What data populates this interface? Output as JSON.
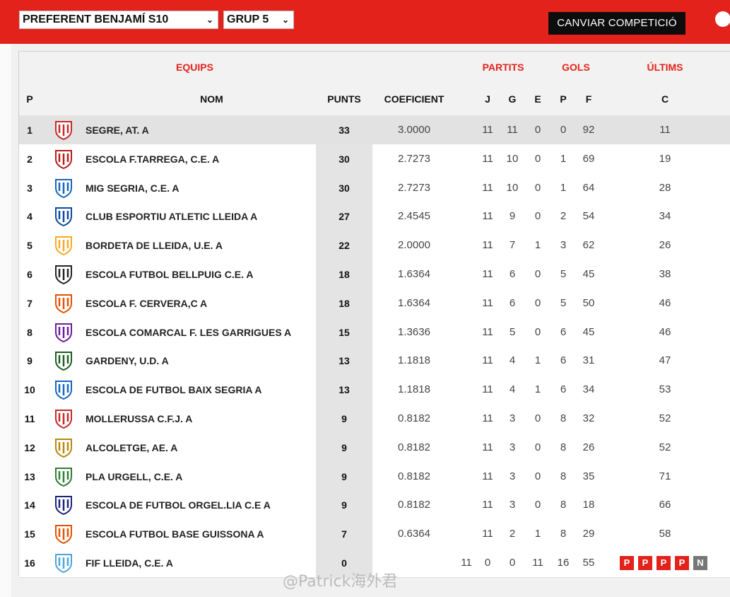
{
  "header": {
    "competition_select": "PREFERENT BENJAMÍ S10",
    "group_select": "GRUP 5",
    "change_button": "CANVIAR COMPETICIÓ"
  },
  "colors": {
    "accent": "#e3231b",
    "loss_badge": "#e3231b",
    "draw_badge": "#777777"
  },
  "table": {
    "group_headers": {
      "equips": "EQUIPS",
      "partits": "PARTITS",
      "gols": "GOLS",
      "ultims": "ÚLTIMS"
    },
    "columns": {
      "p": "P",
      "nom": "NOM",
      "punts": "PUNTS",
      "coeficient": "COEFICIENT",
      "j": "J",
      "g": "G",
      "e": "E",
      "pp": "P",
      "f": "F",
      "c": "C"
    },
    "rows": [
      {
        "pos": "1",
        "name": "SEGRE, AT. A",
        "pts": "33",
        "coef": "3.0000",
        "j": "11",
        "g": "11",
        "e": "0",
        "p": "0",
        "f": "92",
        "c": "11",
        "logo_icon": "shield-red-white-stripes-icon"
      },
      {
        "pos": "2",
        "name": "ESCOLA F.TARREGA, C.E. A",
        "pts": "30",
        "coef": "2.7273",
        "j": "11",
        "g": "10",
        "e": "0",
        "p": "1",
        "f": "69",
        "c": "19",
        "logo_icon": "round-crest-red-icon"
      },
      {
        "pos": "3",
        "name": "MIG SEGRIA, C.E. A",
        "pts": "30",
        "coef": "2.7273",
        "j": "11",
        "g": "10",
        "e": "0",
        "p": "1",
        "f": "64",
        "c": "28",
        "logo_icon": "diamond-crest-blue-icon"
      },
      {
        "pos": "4",
        "name": "CLUB ESPORTIU ATLETIC LLEIDA A",
        "pts": "27",
        "coef": "2.4545",
        "j": "11",
        "g": "9",
        "e": "0",
        "p": "2",
        "f": "54",
        "c": "34",
        "logo_icon": "round-crest-blue-icon"
      },
      {
        "pos": "5",
        "name": "BORDETA DE LLEIDA, U.E. A",
        "pts": "22",
        "coef": "2.0000",
        "j": "11",
        "g": "7",
        "e": "1",
        "p": "3",
        "f": "62",
        "c": "26",
        "logo_icon": "shield-yellow-red-icon"
      },
      {
        "pos": "6",
        "name": "ESCOLA FUTBOL BELLPUIG C.E. A",
        "pts": "18",
        "coef": "1.6364",
        "j": "11",
        "g": "6",
        "e": "0",
        "p": "5",
        "f": "45",
        "c": "38",
        "logo_icon": "crest-black-white-icon"
      },
      {
        "pos": "7",
        "name": "ESCOLA F. CERVERA,C A",
        "pts": "18",
        "coef": "1.6364",
        "j": "11",
        "g": "6",
        "e": "0",
        "p": "5",
        "f": "50",
        "c": "46",
        "logo_icon": "shield-orange-icon"
      },
      {
        "pos": "8",
        "name": "ESCOLA COMARCAL F. LES GARRIGUES A",
        "pts": "15",
        "coef": "1.3636",
        "j": "11",
        "g": "5",
        "e": "0",
        "p": "6",
        "f": "45",
        "c": "46",
        "logo_icon": "round-crest-purple-icon"
      },
      {
        "pos": "9",
        "name": "GARDENY, U.D. A",
        "pts": "13",
        "coef": "1.1818",
        "j": "11",
        "g": "4",
        "e": "1",
        "p": "6",
        "f": "31",
        "c": "47",
        "logo_icon": "shield-green-icon"
      },
      {
        "pos": "10",
        "name": "ESCOLA DE FUTBOL BAIX SEGRIA A",
        "pts": "13",
        "coef": "1.1818",
        "j": "11",
        "g": "4",
        "e": "1",
        "p": "6",
        "f": "34",
        "c": "53",
        "logo_icon": "shield-blue-yellow-icon"
      },
      {
        "pos": "11",
        "name": "MOLLERUSSA C.F.J. A",
        "pts": "9",
        "coef": "0.8182",
        "j": "11",
        "g": "3",
        "e": "0",
        "p": "8",
        "f": "32",
        "c": "52",
        "logo_icon": "shield-red-yellow-stripes-icon"
      },
      {
        "pos": "12",
        "name": "ALCOLETGE, AE. A",
        "pts": "9",
        "coef": "0.8182",
        "j": "11",
        "g": "3",
        "e": "0",
        "p": "8",
        "f": "26",
        "c": "52",
        "logo_icon": "crest-crown-icon"
      },
      {
        "pos": "13",
        "name": "PLA URGELL, C.E. A",
        "pts": "9",
        "coef": "0.8182",
        "j": "11",
        "g": "3",
        "e": "0",
        "p": "8",
        "f": "35",
        "c": "71",
        "logo_icon": "shield-green-blue-icon"
      },
      {
        "pos": "14",
        "name": "ESCOLA DE FUTBOL ORGEL.LIA C.E A",
        "pts": "9",
        "coef": "0.8182",
        "j": "11",
        "g": "3",
        "e": "0",
        "p": "8",
        "f": "18",
        "c": "66",
        "logo_icon": "crest-navy-red-icon"
      },
      {
        "pos": "15",
        "name": "ESCOLA FUTBOL BASE GUISSONA A",
        "pts": "7",
        "coef": "0.6364",
        "j": "11",
        "g": "2",
        "e": "1",
        "p": "8",
        "f": "29",
        "c": "58",
        "logo_icon": "crest-orange-stripes-icon"
      },
      {
        "pos": "16",
        "name": "FIF LLEIDA, C.E. A",
        "pts": "0",
        "coef": "11",
        "j": "0",
        "g": "0",
        "e": "11",
        "p": "16",
        "f": "55",
        "c": "",
        "logo_icon": "round-crest-lightblue-icon",
        "last": [
          "P",
          "P",
          "P",
          "P",
          "N"
        ]
      }
    ]
  },
  "watermark": "@Patrick海外君"
}
